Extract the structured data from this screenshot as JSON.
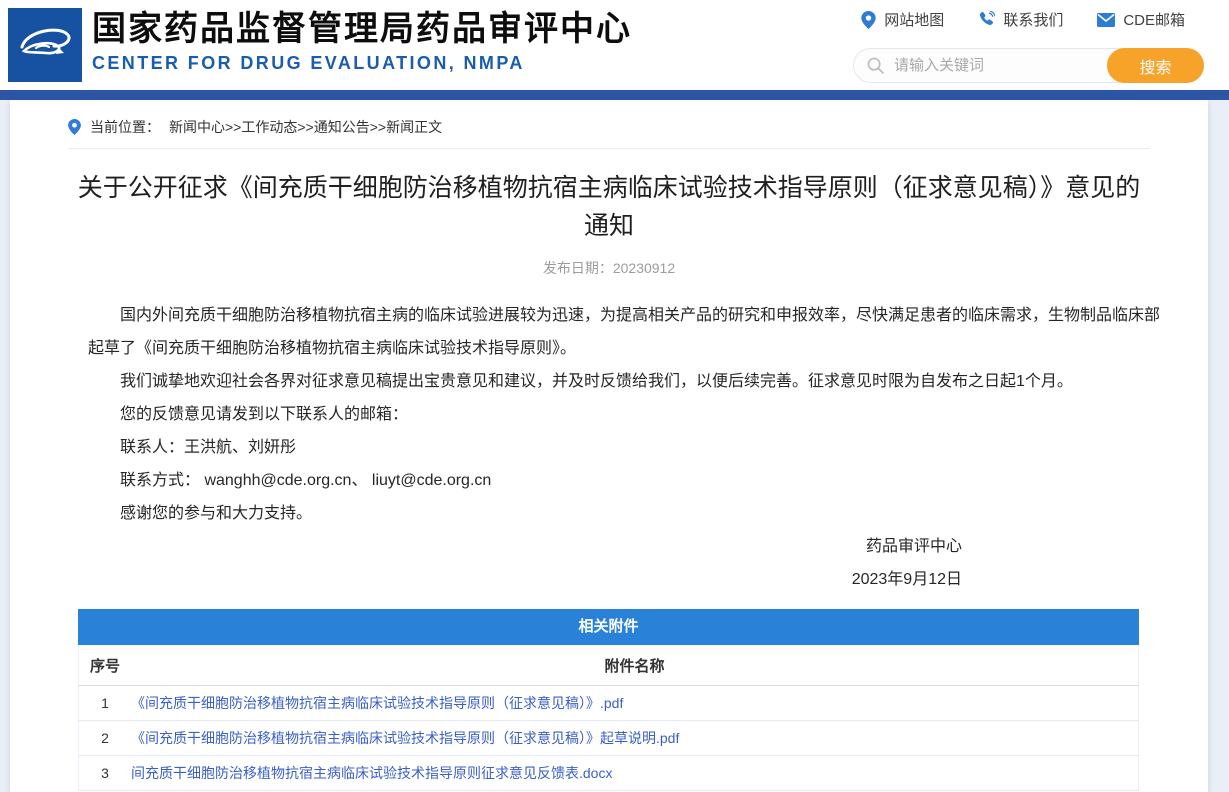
{
  "header": {
    "logo_name": "cde-logo",
    "title_cn": "国家药品监督管理局药品审评中心",
    "title_en": "CENTER FOR DRUG EVALUATION, NMPA",
    "quick_links": [
      {
        "icon": "location-pin-icon",
        "label": "网站地图"
      },
      {
        "icon": "phone-icon",
        "label": "联系我们"
      },
      {
        "icon": "envelope-icon",
        "label": "CDE邮箱"
      }
    ],
    "search": {
      "placeholder": "请输入关键词",
      "button_label": "搜索"
    }
  },
  "breadcrumb": {
    "prefix": "当前位置：",
    "separator": ">>",
    "items": [
      "新闻中心",
      "工作动态",
      "通知公告",
      "新闻正文"
    ]
  },
  "article": {
    "title": "关于公开征求《间充质干细胞防治移植物抗宿主病临床试验技术指导原则（征求意见稿）》意见的通知",
    "publish_date": "发布日期：20230912",
    "paragraphs": [
      "国内外间充质干细胞防治移植物抗宿主病的临床试验进展较为迅速，为提高相关产品的研究和申报效率，尽快满足患者的临床需求，生物制品临床部起草了《间充质干细胞防治移植物抗宿主病临床试验技术指导原则》。",
      "我们诚挚地欢迎社会各界对征求意见稿提出宝贵意见和建议，并及时反馈给我们，以便后续完善。征求意见时限为自发布之日起1个月。",
      "您的反馈意见请发到以下联系人的邮箱：",
      "联系人：王洪航、刘妍彤",
      "联系方式： wanghh@cde.org.cn、 liuyt@cde.org.cn",
      "感谢您的参与和大力支持。"
    ],
    "signature": {
      "org": "药品审评中心",
      "date": "2023年9月12日"
    }
  },
  "attachments": {
    "title": "相关附件",
    "columns": {
      "index": "序号",
      "name": "附件名称"
    },
    "rows": [
      {
        "index": "1",
        "name": "《间充质干细胞防治移植物抗宿主病临床试验技术指导原则（征求意见稿）》.pdf"
      },
      {
        "index": "2",
        "name": "《间充质干细胞防治移植物抗宿主病临床试验技术指导原则（征求意见稿）》起草说明.pdf"
      },
      {
        "index": "3",
        "name": "间充质干细胞防治移植物抗宿主病临床试验技术指导原则征求意见反馈表.docx"
      }
    ]
  },
  "colors": {
    "brand_blue": "#1652a1",
    "subtitle_blue": "#1a5dae",
    "top_bar_blue": "#2d55a5",
    "icon_blue": "#2f7cd6",
    "search_button_orange": "#f7a32a",
    "table_header_blue": "#2a81d8",
    "link_blue": "#3a5fc8"
  }
}
